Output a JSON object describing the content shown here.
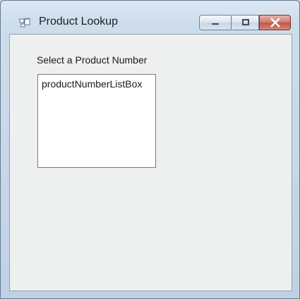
{
  "window": {
    "title": "Product Lookup",
    "icon": "window-form-icon"
  },
  "title_controls": {
    "minimize_icon": "minimize-icon",
    "maximize_icon": "maximize-icon",
    "close_icon": "close-icon"
  },
  "form": {
    "prompt_label": "Select a Product Number",
    "listbox_item": "productNumberListBox"
  },
  "colors": {
    "window_frame": "#c7d6e3",
    "client_background": "#eef0ef",
    "close_button": "#bf5848"
  }
}
